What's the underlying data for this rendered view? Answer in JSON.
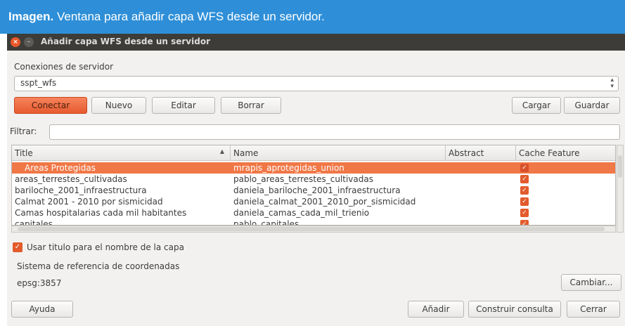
{
  "caption": {
    "bold": "Imagen.",
    "text": " Ventana para añadir capa WFS desde un servidor."
  },
  "window": {
    "title": "Añadir capa WFS desde un servidor",
    "close_glyph": "×",
    "min_glyph": "–"
  },
  "connections": {
    "label": "Conexiones de servidor",
    "selected": "sspt_wfs",
    "buttons": {
      "connect": "Conectar",
      "new": "Nuevo",
      "edit": "Editar",
      "delete": "Borrar",
      "load": "Cargar",
      "save": "Guardar"
    }
  },
  "filter": {
    "label": "Filtrar:",
    "value": ""
  },
  "table": {
    "columns": [
      "Title",
      "Name",
      "Abstract",
      "Cache Feature"
    ],
    "rows": [
      {
        "title": "Areas Protegidas",
        "name": "mrapis_aprotegidas_union",
        "abstract": "",
        "cache": true,
        "selected": true
      },
      {
        "title": "areas_terrestes_cultivadas",
        "name": "pablo_areas_terrestes_cultivadas",
        "abstract": "",
        "cache": true,
        "selected": false
      },
      {
        "title": "bariloche_2001_infraestructura",
        "name": "daniela_bariloche_2001_infraestructura",
        "abstract": "",
        "cache": true,
        "selected": false
      },
      {
        "title": "Calmat 2001 - 2010 por sismicidad",
        "name": "daniela_calmat_2001_2010_por_sismicidad",
        "abstract": "",
        "cache": true,
        "selected": false
      },
      {
        "title": "Camas hospitalarias cada mil habitantes",
        "name": "daniela_camas_cada_mil_trienio",
        "abstract": "",
        "cache": true,
        "selected": false
      },
      {
        "title": "capitales",
        "name": "pablo_capitales",
        "abstract": "",
        "cache": true,
        "selected": false
      }
    ]
  },
  "use_title": {
    "label": "Usar titulo para el nombre de la capa",
    "checked": true
  },
  "crs": {
    "label": "Sistema de referencia de coordenadas",
    "value": "epsg:3857",
    "change_button": "Cambiar..."
  },
  "footer": {
    "help": "Ayuda",
    "add": "Añadir",
    "build_query": "Construir consulta",
    "close": "Cerrar"
  },
  "colors": {
    "accent": "#f07746",
    "caption_bg": "#2e8fd8",
    "titlebar_bg": "#3d3c38"
  }
}
